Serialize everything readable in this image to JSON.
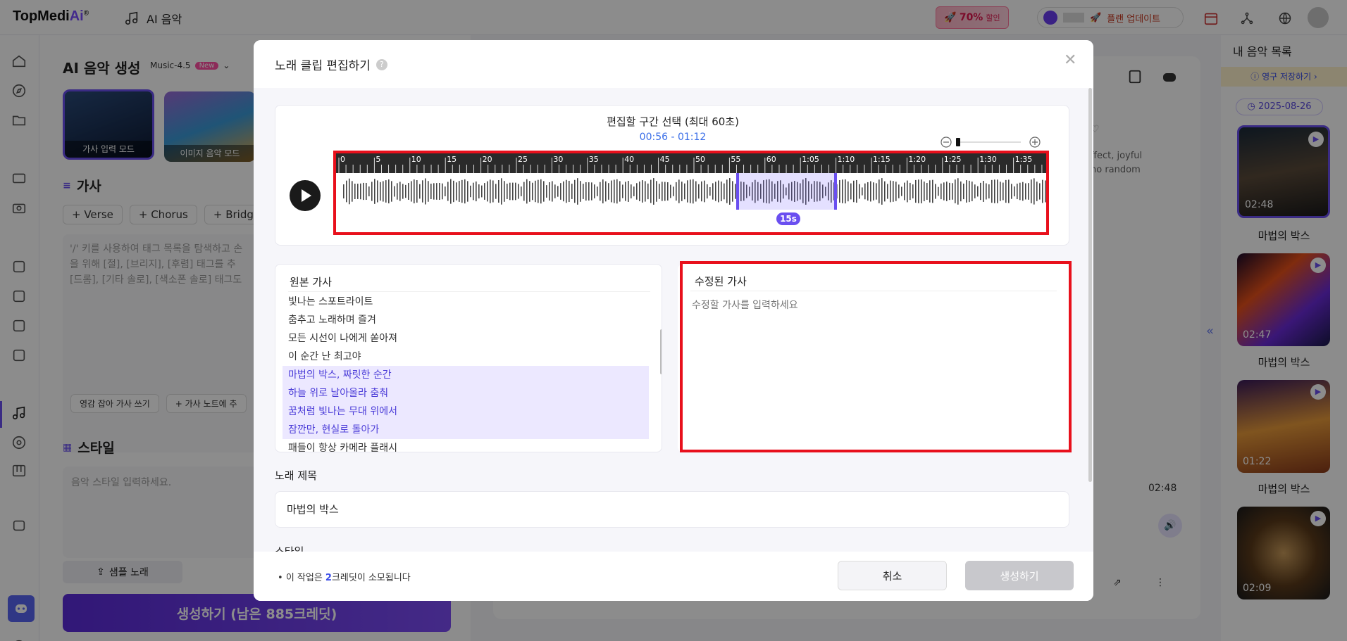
{
  "app": {
    "logo_text": "TopMedi",
    "logo_ai": "Ai",
    "logo_reg": "®",
    "section_title": "AI 음악",
    "promo": {
      "percent": "70%",
      "label": "할인"
    },
    "plan_update": "플랜 업데이트"
  },
  "generator": {
    "title": "AI 음악 생성",
    "model": "Music-4.5",
    "model_badge": "New",
    "modes": [
      "가사 입력 모드",
      "이미지 음악 모드"
    ],
    "lyrics_heading": "가사",
    "tag_buttons": [
      "+ Verse",
      "+ Chorus",
      "+ Bridge"
    ],
    "lyrics_placeholder": "'/' 키를 사용하여 태그 목록을 탐색하고 손\n을 위해 [절], [브리지], [후렴] 태그를 추\n[드롬], [기타 솔로], [색소폰 솔로] 태그도",
    "inspire_btn": "영감 잡아 가사 쓰기",
    "notes_btn": "+ 가사 노트에 추",
    "style_heading": "스타일",
    "style_placeholder": "음악 스타일 입력하세요.",
    "sample_btn": "샘플 노래",
    "generate_btn": "생성하기 (남은 885크레딧)"
  },
  "right_bg": {
    "snippet": [
      "ffect, joyful",
      "no random"
    ],
    "duration": "02:48"
  },
  "my_music": {
    "title": "내 음악 목록",
    "notice": "영구 저장하기 ›",
    "date": "2025-08-26",
    "songs": [
      {
        "name": "마법의 박스",
        "time": "02:48"
      },
      {
        "name": "마법의 박스",
        "time": "02:47"
      },
      {
        "name": "마법의 박스",
        "time": "01:22"
      },
      {
        "name": "",
        "time": "02:09"
      }
    ]
  },
  "modal": {
    "title": "노래 클립 편집하기",
    "range_label": "편집할 구간 선택 (최대 60초)",
    "range_time": "00:56 - 01:12",
    "timeline_ticks": [
      "0",
      "5",
      "10",
      "15",
      "20",
      "25",
      "30",
      "35",
      "40",
      "45",
      "50",
      "55",
      "60",
      "1:05",
      "1:10",
      "1:15",
      "1:20",
      "1:25",
      "1:30",
      "1:35",
      "1"
    ],
    "selection_badge": "15s",
    "original_lyrics_title": "원본 가사",
    "original_lyrics": [
      {
        "text": "빛나는 스포트라이트",
        "selected": false
      },
      {
        "text": "춤추고 노래하며 즐겨",
        "selected": false
      },
      {
        "text": "모든 시선이 나에게 쏟아져",
        "selected": false
      },
      {
        "text": "이 순간 난 최고야",
        "selected": false
      },
      {
        "text": "마법의 박스, 짜릿한 순간",
        "selected": true
      },
      {
        "text": "하늘 위로 날아올라 춤춰",
        "selected": true
      },
      {
        "text": "꿈처럼 빛나는 무대 위에서",
        "selected": true
      },
      {
        "text": "잠깐만, 현실로 돌아가",
        "selected": true
      },
      {
        "text": "패들이 항상 카메라 플래시",
        "selected": false
      }
    ],
    "edited_lyrics_title": "수정된 가사",
    "edited_lyrics_placeholder": "수정할 가사를 입력하세요",
    "song_title_label": "노래 제목",
    "song_title_value": "마법의 박스",
    "style_label": "스타일",
    "credit_prefix": "이 작업은 ",
    "credit_amount": "2",
    "credit_suffix": "크레딧이 소모됩니다",
    "cancel": "취소",
    "create": "생성하기"
  },
  "colors": {
    "accent": "#6a4ff0",
    "highlight_red": "#e8101c",
    "link_blue": "#3a6ee8"
  }
}
